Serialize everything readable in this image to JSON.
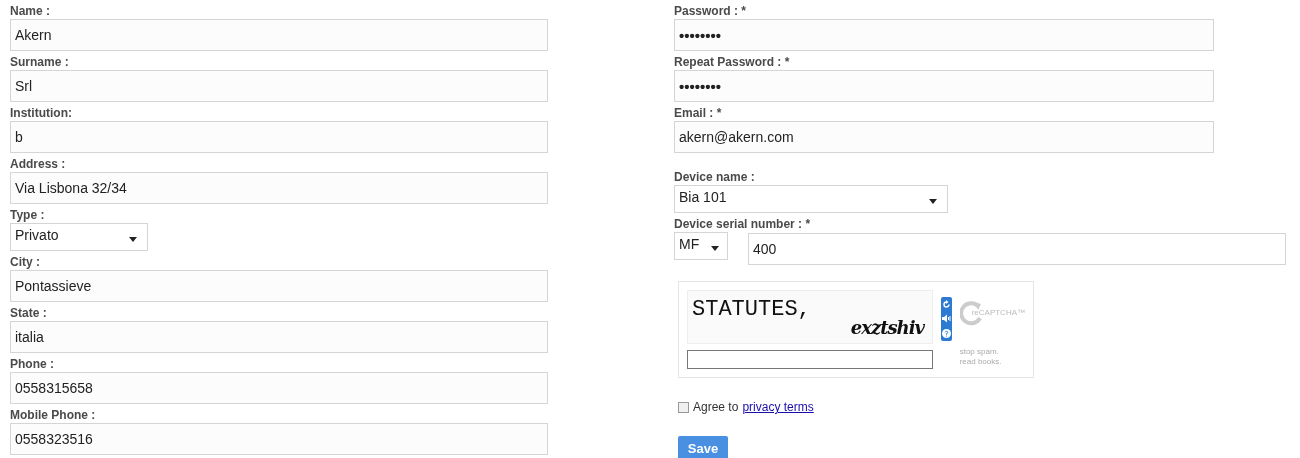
{
  "left_fields": [
    {
      "label": "Name :",
      "kind": "text",
      "value": "Akern"
    },
    {
      "label": "Surname :",
      "kind": "text",
      "value": "Srl"
    },
    {
      "label": "Institution:",
      "kind": "text",
      "value": "b"
    },
    {
      "label": "Address :",
      "kind": "text",
      "value": "Via Lisbona 32/34"
    },
    {
      "label": "Type :",
      "kind": "select",
      "value": "Privato"
    },
    {
      "label": "City :",
      "kind": "text",
      "value": "Pontassieve"
    },
    {
      "label": "State :",
      "kind": "text",
      "value": "italia"
    },
    {
      "label": "Phone :",
      "kind": "text",
      "value": "0558315658"
    },
    {
      "label": "Mobile Phone :",
      "kind": "text",
      "value": "0558323516"
    }
  ],
  "right_fields": [
    {
      "label": "Password : *",
      "kind": "password",
      "value": "••••••••"
    },
    {
      "label": "Repeat Password : *",
      "kind": "password",
      "value": "••••••••"
    },
    {
      "label": "Email : *",
      "kind": "text",
      "value": "akern@akern.com"
    },
    {
      "label": "Device name :",
      "kind": "select",
      "value": "Bia 101"
    },
    {
      "label": "Device serial number : *",
      "kind": "serial",
      "prefix": "MF",
      "value": "400"
    }
  ],
  "captcha": {
    "words": [
      "STATUTES,",
      "exztshiv"
    ],
    "logo": "reCAPTCHA™",
    "slogan": [
      "stop spam.",
      "read books."
    ]
  },
  "agree": {
    "checked": false,
    "text": "Agree to",
    "link": "privacy terms"
  },
  "save_button": "Save"
}
